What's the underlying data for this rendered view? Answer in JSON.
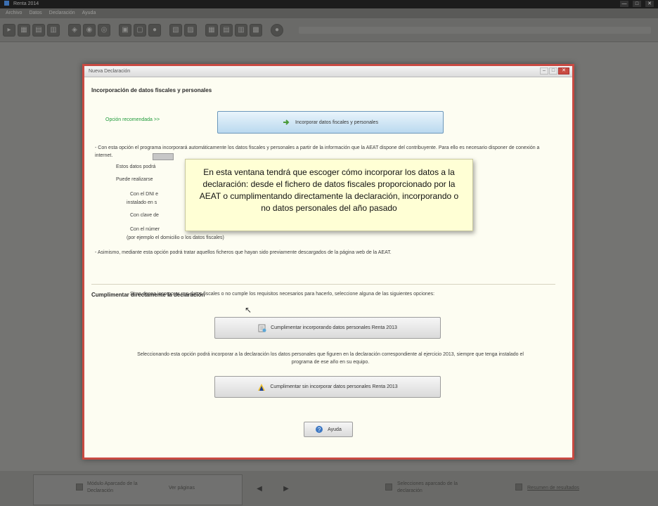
{
  "window": {
    "title": "Renta 2014",
    "controls": [
      "—",
      "□",
      "✕"
    ]
  },
  "menubar": [
    "Archivo",
    "Datos",
    "Declaración",
    "Ayuda"
  ],
  "dialog": {
    "title": "Nueva Declaración",
    "section1": {
      "heading": "Incorporación de datos fiscales y personales",
      "recommended_label": "Opción recomendada >>",
      "incorporate_button": "Incorporar datos fiscales y personales",
      "desc1": "- Con esta opción el programa incorporará automáticamente los datos fiscales y personales a partir de la información que la AEAT dispone del contribuyente. Para ello es necesario disponer de conexión a internet.",
      "line_a": "Estos datos podrá",
      "line_b": "Puede realizarse",
      "line_c": "Con el DNI e",
      "line_c2": "instalado en s",
      "line_d": "Con clave de",
      "line_e": "Con el númer",
      "line_e2": "(por ejemplo el domicilio o los datos fiscales)",
      "desc2": "- Asimismo, mediante esta opción podrá tratar aquellos ficheros que hayan sido previamente descargados de la página web de la AEAT."
    },
    "tooltip": "En esta ventana tendrá que escoger cómo incorporar los datos a la declaración: desde el fichero de datos fiscales proporcionado por la AEAT o cumplimentando directamente la declaración, incorporando o no datos personales del año pasado",
    "section2": {
      "heading": "Cumplimentar directamente la declaración",
      "desc1": "Si no desea incorporar sus datos fiscales o no cumple los requisitos necesarios para hacerlo, seleccione alguna de las siguientes opciones:",
      "button1": "Cumplimentar incorporando datos personales Renta 2013",
      "desc2": "Seleccionando esta opción podrá incorporar a la declaración los datos personales que figuren en la declaración correspondiente al ejercicio 2013, siempre que tenga instalado el programa de ese año en su equipo.",
      "button2": "Cumplimentar sin incorporar datos personales Renta 2013"
    },
    "help_button": "Ayuda"
  },
  "statusbar": {
    "panel_text": "Módulo Aparcado de la Declaración",
    "page_select": "Ver páginas",
    "prev": "◀",
    "next": "▶",
    "middle_text": "Selecciones aparcado de la declaración",
    "summary_link": "Resumen de resultados"
  },
  "colors": {
    "dialog_border": "#c84a42",
    "dialog_bg": "#fdfdf2",
    "tooltip_bg": "#ffffd5",
    "recommended_text": "#1f9a3a"
  }
}
